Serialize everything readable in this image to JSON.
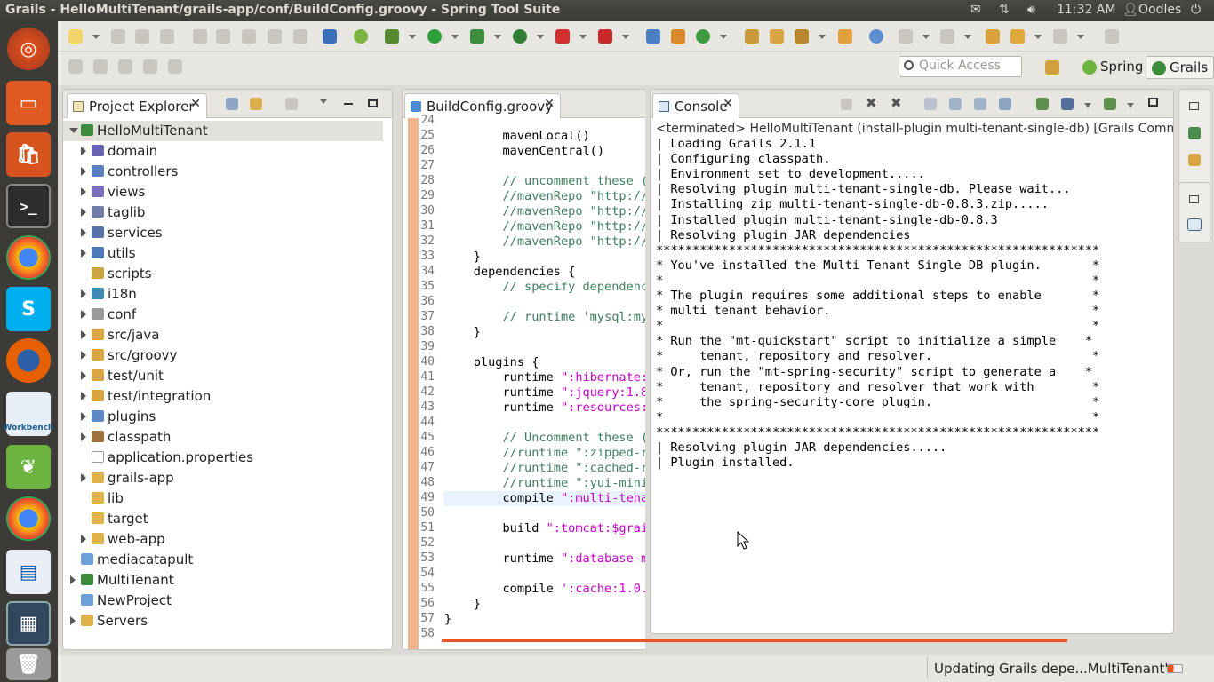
{
  "window": {
    "title": "Grails - HelloMultiTenant/grails-app/conf/BuildConfig.groovy - Spring Tool Suite",
    "clock": "11:32 AM",
    "user": "Oodles"
  },
  "launcher": [
    {
      "name": "ubuntu-dash-icon"
    },
    {
      "name": "files-icon"
    },
    {
      "name": "software-center-icon"
    },
    {
      "name": "terminal-icon"
    },
    {
      "name": "chrome-icon"
    },
    {
      "name": "skype-icon"
    },
    {
      "name": "firefox-icon"
    },
    {
      "name": "mysql-workbench-icon",
      "label": "Workbench"
    },
    {
      "name": "spring-tool-suite-icon"
    },
    {
      "name": "chrome-icon-2"
    },
    {
      "name": "libreoffice-writer-icon"
    },
    {
      "name": "workspace-switcher-icon"
    },
    {
      "name": "trash-icon"
    }
  ],
  "toolbar": {
    "quick_access_placeholder": "Quick Access",
    "perspective_spring": "Spring",
    "perspective_grails": "Grails"
  },
  "project_explorer": {
    "tab_label": "Project Explorer",
    "items": [
      {
        "label": "HelloMultiTenant",
        "level": 0,
        "expandable": true,
        "open": true,
        "icon": "grails-project-icon"
      },
      {
        "label": "domain",
        "level": 1,
        "expandable": true,
        "icon": "domain-icon"
      },
      {
        "label": "controllers",
        "level": 1,
        "expandable": true,
        "icon": "controllers-icon"
      },
      {
        "label": "views",
        "level": 1,
        "expandable": true,
        "icon": "views-icon"
      },
      {
        "label": "taglib",
        "level": 1,
        "expandable": true,
        "icon": "taglib-icon"
      },
      {
        "label": "services",
        "level": 1,
        "expandable": true,
        "icon": "services-icon"
      },
      {
        "label": "utils",
        "level": 1,
        "expandable": true,
        "icon": "utils-icon"
      },
      {
        "label": "scripts",
        "level": 1,
        "expandable": false,
        "icon": "scripts-icon"
      },
      {
        "label": "i18n",
        "level": 1,
        "expandable": true,
        "icon": "i18n-icon"
      },
      {
        "label": "conf",
        "level": 1,
        "expandable": true,
        "icon": "conf-icon"
      },
      {
        "label": "src/java",
        "level": 1,
        "expandable": true,
        "icon": "source-folder-icon"
      },
      {
        "label": "src/groovy",
        "level": 1,
        "expandable": true,
        "icon": "source-folder-icon"
      },
      {
        "label": "test/unit",
        "level": 1,
        "expandable": true,
        "icon": "source-folder-icon"
      },
      {
        "label": "test/integration",
        "level": 1,
        "expandable": true,
        "icon": "source-folder-icon"
      },
      {
        "label": "plugins",
        "level": 1,
        "expandable": true,
        "icon": "plugins-icon"
      },
      {
        "label": "classpath",
        "level": 1,
        "expandable": true,
        "icon": "classpath-icon"
      },
      {
        "label": "application.properties",
        "level": 1,
        "expandable": false,
        "icon": "file-icon"
      },
      {
        "label": "grails-app",
        "level": 1,
        "expandable": true,
        "icon": "folder-icon"
      },
      {
        "label": "lib",
        "level": 1,
        "expandable": false,
        "icon": "folder-icon"
      },
      {
        "label": "target",
        "level": 1,
        "expandable": false,
        "icon": "folder-icon"
      },
      {
        "label": "web-app",
        "level": 1,
        "expandable": true,
        "icon": "folder-icon"
      },
      {
        "label": "mediacatapult",
        "level": 0,
        "expandable": false,
        "icon": "project-icon"
      },
      {
        "label": "MultiTenant",
        "level": 0,
        "expandable": true,
        "icon": "grails-project-icon"
      },
      {
        "label": "NewProject",
        "level": 0,
        "expandable": false,
        "icon": "project-icon"
      },
      {
        "label": "Servers",
        "level": 0,
        "expandable": true,
        "icon": "folder-icon"
      }
    ]
  },
  "editor": {
    "tab_label": "BuildConfig.groovy",
    "lines": [
      {
        "n": "24",
        "t": ""
      },
      {
        "n": "25",
        "t": "        mavenLocal()"
      },
      {
        "n": "26",
        "t": "        mavenCentral()"
      },
      {
        "n": "27",
        "t": ""
      },
      {
        "n": "28",
        "t": "        // uncomment these (",
        "c": "comment"
      },
      {
        "n": "29",
        "t": "        //mavenRepo \"http://",
        "c": "comment"
      },
      {
        "n": "30",
        "t": "        //mavenRepo \"http://",
        "c": "comment"
      },
      {
        "n": "31",
        "t": "        //mavenRepo \"http://",
        "c": "comment"
      },
      {
        "n": "32",
        "t": "        //mavenRepo \"http://",
        "c": "comment"
      },
      {
        "n": "33",
        "t": "    }"
      },
      {
        "n": "34",
        "t": "    dependencies {"
      },
      {
        "n": "35",
        "t": "        // specify dependenc",
        "c": "comment"
      },
      {
        "n": "36",
        "t": ""
      },
      {
        "n": "37",
        "t": "        // runtime 'mysql:my",
        "c": "comment"
      },
      {
        "n": "38",
        "t": "    }"
      },
      {
        "n": "39",
        "t": ""
      },
      {
        "n": "40",
        "t": "    plugins {"
      },
      {
        "n": "41",
        "t": "        runtime \":hibernate:",
        "c": "str"
      },
      {
        "n": "42",
        "t": "        runtime \":jquery:1.8",
        "c": "str"
      },
      {
        "n": "43",
        "t": "        runtime \":resources:",
        "c": "str"
      },
      {
        "n": "44",
        "t": ""
      },
      {
        "n": "45",
        "t": "        // Uncomment these (",
        "c": "comment"
      },
      {
        "n": "46",
        "t": "        //runtime \":zipped-r",
        "c": "comment"
      },
      {
        "n": "47",
        "t": "        //runtime \":cached-r",
        "c": "comment"
      },
      {
        "n": "48",
        "t": "        //runtime \":yui-mini",
        "c": "comment"
      },
      {
        "n": "49",
        "t": "        compile \":multi-tena",
        "c": "str",
        "hl": true
      },
      {
        "n": "50",
        "t": ""
      },
      {
        "n": "51",
        "t": "        build \":tomcat:$grai",
        "c": "str"
      },
      {
        "n": "52",
        "t": ""
      },
      {
        "n": "53",
        "t": "        runtime \":database-m",
        "c": "str"
      },
      {
        "n": "54",
        "t": ""
      },
      {
        "n": "55",
        "t": "        compile ':cache:1.0.",
        "c": "str"
      },
      {
        "n": "56",
        "t": "    }"
      },
      {
        "n": "57",
        "t": "}"
      },
      {
        "n": "58",
        "t": ""
      }
    ]
  },
  "console": {
    "tab_label": "Console",
    "header": "<terminated> HelloMultiTenant (install-plugin multi-tenant-single-db) [Grails Command",
    "lines": [
      "| Loading Grails 2.1.1",
      "| Configuring classpath.",
      "| Environment set to development.....",
      "| Resolving plugin multi-tenant-single-db. Please wait...",
      "| Installing zip multi-tenant-single-db-0.8.3.zip.....",
      "| Installed plugin multi-tenant-single-db-0.8.3",
      "| Resolving plugin JAR dependencies",
      "*************************************************************",
      "* You've installed the Multi Tenant Single DB plugin.       *",
      "*                                                           *",
      "* The plugin requires some additional steps to enable       *",
      "* multi tenant behavior.                                    *",
      "*                                                           *",
      "* Run the \"mt-quickstart\" script to initialize a simple    *",
      "*     tenant, repository and resolver.                      *",
      "* Or, run the \"mt-spring-security\" script to generate a    *",
      "*     tenant, repository and resolver that work with        *",
      "*     the spring-security-core plugin.                      *",
      "*                                                           *",
      "*************************************************************",
      "| Resolving plugin JAR dependencies.....",
      "| Plugin installed."
    ]
  },
  "status": {
    "text": "Updating Grails depe...MultiTenant'"
  },
  "colors": {
    "comment": "#3f7f5f",
    "string": "#c800c8",
    "keyword": "#000000",
    "accent": "#e95420"
  }
}
